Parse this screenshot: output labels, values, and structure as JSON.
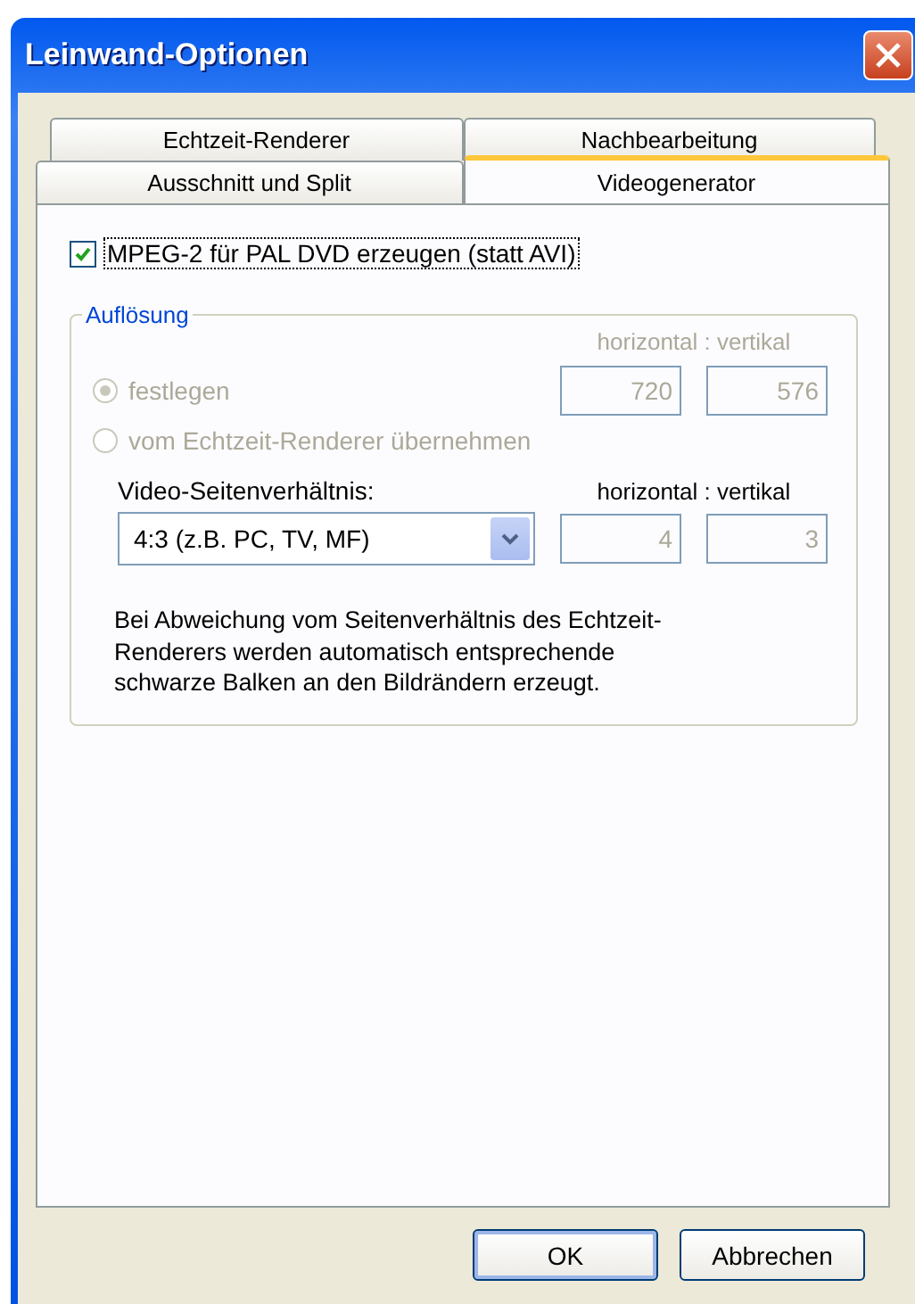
{
  "window": {
    "title": "Leinwand-Optionen"
  },
  "tab_rows": [
    [
      {
        "label": "Echtzeit-Renderer",
        "selected": false
      },
      {
        "label": "Nachbearbeitung",
        "selected": false
      }
    ],
    [
      {
        "label": "Ausschnitt und Split",
        "selected": false
      },
      {
        "label": "Videogenerator",
        "selected": true
      }
    ]
  ],
  "mpeg_checkbox": {
    "label": "MPEG-2 für PAL DVD erzeugen (statt AVI)",
    "checked": true,
    "focused": true
  },
  "resolution_group": {
    "title": "Auflösung",
    "disabled": true,
    "size_header": "horizontal : vertikal",
    "options": [
      {
        "label": "festlegen",
        "selected": true
      },
      {
        "label": "vom Echtzeit-Renderer übernehmen",
        "selected": false
      }
    ],
    "horizontal": "720",
    "vertical": "576"
  },
  "aspect": {
    "label": "Video-Seitenverhältnis:",
    "size_header": "horizontal : vertikal",
    "value": "4:3 (z.B. PC, TV, MF)",
    "horizontal": "4",
    "vertical": "3",
    "fields_disabled": true
  },
  "note": "Bei Abweichung vom Seitenverhältnis des Echtzeit-Renderers werden automatisch entsprechende schwarze Balken an den Bildrändern erzeugt.",
  "buttons": [
    {
      "label": "OK",
      "default": true
    },
    {
      "label": "Abbrechen",
      "default": false
    }
  ]
}
